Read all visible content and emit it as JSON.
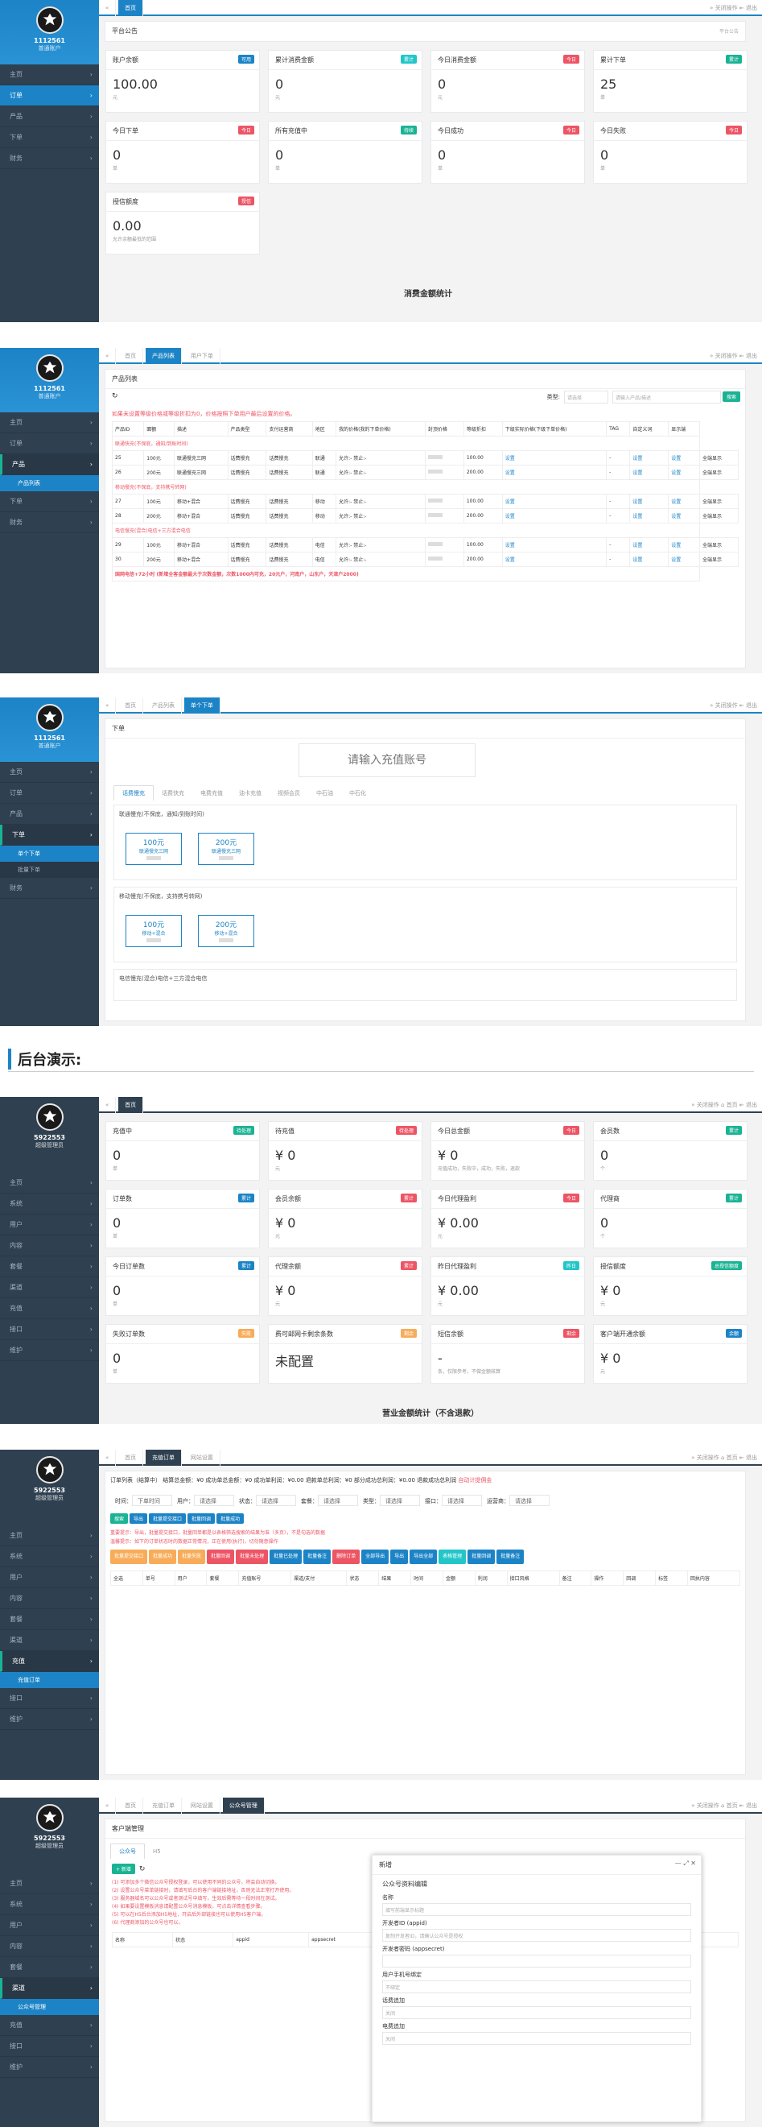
{
  "common": {
    "user_name": "1112561",
    "user_role": "普通账户",
    "admin_name": "5922553",
    "admin_role": "超级管理员",
    "close_ops": "关闭操作",
    "exit": "退出",
    "home": "首页"
  },
  "panel1": {
    "menu": [
      "主页",
      "订单",
      "产品",
      "下单",
      "财务"
    ],
    "notice_title": "平台公告",
    "notice_right": "平台公告",
    "cards": [
      {
        "title": "账户余额",
        "badge": "可用",
        "badge_color": "#1c84c6",
        "value": "100.00",
        "unit": "元"
      },
      {
        "title": "累计消费金额",
        "badge": "累计",
        "badge_color": "#23c6c8",
        "value": "0",
        "unit": "元"
      },
      {
        "title": "今日消费金额",
        "badge": "今日",
        "badge_color": "#ed5565",
        "value": "0",
        "unit": "元"
      },
      {
        "title": "累计下单",
        "badge": "累计",
        "badge_color": "#1ab394",
        "value": "25",
        "unit": "单"
      },
      {
        "title": "今日下单",
        "badge": "今日",
        "badge_color": "#ed5565",
        "value": "0",
        "unit": "单"
      },
      {
        "title": "所有充值中",
        "badge": "待续",
        "badge_color": "#1ab394",
        "value": "0",
        "unit": "单"
      },
      {
        "title": "今日成功",
        "badge": "今日",
        "badge_color": "#ed5565",
        "value": "0",
        "unit": "单"
      },
      {
        "title": "今日失败",
        "badge": "今日",
        "badge_color": "#ed5565",
        "value": "0",
        "unit": "单"
      },
      {
        "title": "授信额度",
        "badge": "授信",
        "badge_color": "#ed5565",
        "value": "0.00",
        "unit": "允许余额最低的范围"
      }
    ],
    "caption": "消费金额统计"
  },
  "panel2": {
    "menu": [
      "主页",
      "订单",
      "产品",
      "下单",
      "财务"
    ],
    "submenu": "产品列表",
    "tabs": [
      "首页",
      "产品列表",
      "用户下单"
    ],
    "title": "产品列表",
    "type_label": "类型:",
    "type_select": "请选择",
    "search_placeholder": "请输入产品/描述",
    "search_btn": "搜索",
    "notice": "如果未设置等级价格或等级折扣为0，价格按照下单用户最后设置的价格。",
    "headers": [
      "产品ID",
      "面额",
      "描述",
      "产品类型",
      "支付运营商",
      "地区",
      "我的价格(我的下单价格)",
      "封顶价格",
      "等级折扣",
      "下级实际价格(下级下单价格)",
      "TAG",
      "自定义词",
      "显示端"
    ],
    "sections": [
      {
        "label": "联通快充(不保底，通知/到账时间)",
        "rows": [
          {
            "id": "25",
            "face": "100元",
            "desc": "联通慢充三网",
            "type": "话费慢充",
            "op": "联通",
            "price": "100.00"
          },
          {
            "id": "26",
            "face": "200元",
            "desc": "联通慢充三网",
            "type": "话费慢充",
            "op": "联通",
            "price": "200.00"
          }
        ]
      },
      {
        "label": "移动慢充(不保底，支持携号转网)",
        "rows": [
          {
            "id": "27",
            "face": "100元",
            "desc": "移动+混合",
            "type": "话费慢充",
            "op": "移动",
            "price": "100.00"
          },
          {
            "id": "28",
            "face": "200元",
            "desc": "移动+混合",
            "type": "话费慢充",
            "op": "移动",
            "price": "200.00"
          }
        ]
      },
      {
        "label": "电信慢充(混合)电信+三方混合电信",
        "rows": [
          {
            "id": "29",
            "face": "100元",
            "desc": "移动+混合",
            "type": "话费慢充",
            "op": "电信",
            "price": "100.00"
          },
          {
            "id": "30",
            "face": "200元",
            "desc": "移动+混合",
            "type": "话费慢充",
            "op": "电信",
            "price": "200.00"
          }
        ]
      }
    ],
    "region": "允许:- 禁止:-",
    "set_label": "设置",
    "display_label": "全端显示",
    "footer_notice": "国网电信+72小时 (新增全客金额最大于次数金额，次数1000内可充，20元户，河南户，山东户，天津户2000)"
  },
  "panel3": {
    "menu": [
      "主页",
      "订单",
      "产品",
      "下单",
      "财务"
    ],
    "submenu": [
      "单个下单",
      "批量下单"
    ],
    "tabs": [
      "首页",
      "产品列表",
      "单个下单"
    ],
    "title": "下单",
    "input_placeholder": "请输入充值账号",
    "subtabs": [
      "话费慢充",
      "话费快充",
      "电费充值",
      "油卡充值",
      "视频会员",
      "中石油",
      "中石化"
    ],
    "groups": [
      {
        "title": "联通慢充(不保底，通知/到账时间)",
        "options": [
          {
            "face": "100元",
            "sub": "联通慢充三网"
          },
          {
            "face": "200元",
            "sub": "联通慢充三网"
          }
        ]
      },
      {
        "title": "移动慢充(不保底，支持携号转网)",
        "options": [
          {
            "face": "100元",
            "sub": "移动+混合"
          },
          {
            "face": "200元",
            "sub": "移动+混合"
          }
        ]
      },
      {
        "title": "电信慢充(混合)电信+三方混合电信",
        "options": []
      }
    ]
  },
  "demo_title": "后台演示:",
  "panel4": {
    "menu": [
      "主页",
      "系统",
      "用户",
      "内容",
      "套餐",
      "渠道",
      "充值",
      "接口",
      "维护"
    ],
    "cards": [
      {
        "title": "充值中",
        "badge": "待处理",
        "badge_color": "#1ab394",
        "value": "0",
        "unit": "单"
      },
      {
        "title": "待充值",
        "badge": "待处理",
        "badge_color": "#ed5565",
        "value": "¥ 0",
        "unit": "元"
      },
      {
        "title": "今日总金额",
        "badge": "今日",
        "badge_color": "#ed5565",
        "value": "¥ 0",
        "unit": "充值成功，失败中，成功，失败，退款"
      },
      {
        "title": "会员数",
        "badge": "累计",
        "badge_color": "#1ab394",
        "value": "0",
        "unit": "个"
      },
      {
        "title": "订单数",
        "badge": "累计",
        "badge_color": "#1c84c6",
        "value": "0",
        "unit": "单"
      },
      {
        "title": "会员余额",
        "badge": "累计",
        "badge_color": "#ed5565",
        "value": "¥ 0",
        "unit": "元"
      },
      {
        "title": "今日代理盈利",
        "badge": "今日",
        "badge_color": "#ed5565",
        "value": "¥ 0.00",
        "unit": "元"
      },
      {
        "title": "代理商",
        "badge": "累计",
        "badge_color": "#1ab394",
        "value": "0",
        "unit": "个"
      },
      {
        "title": "今日订单数",
        "badge": "累计",
        "badge_color": "#1c84c6",
        "value": "0",
        "unit": "单"
      },
      {
        "title": "代理余额",
        "badge": "累计",
        "badge_color": "#ed5565",
        "value": "¥ 0",
        "unit": "元"
      },
      {
        "title": "昨日代理盈利",
        "badge": "昨日",
        "badge_color": "#23c6c8",
        "value": "¥ 0.00",
        "unit": "元"
      },
      {
        "title": "授信额度",
        "badge": "总授信额度",
        "badge_color": "#1ab394",
        "value": "¥ 0",
        "unit": "元"
      },
      {
        "title": "失败订单数",
        "badge": "失败",
        "badge_color": "#f8ac59",
        "value": "0",
        "unit": "单"
      },
      {
        "title": "费可邮网卡剩余条数",
        "badge": "剩余",
        "badge_color": "#f8ac59",
        "value": "未配置",
        "unit": ""
      },
      {
        "title": "短信余额",
        "badge": "剩余",
        "badge_color": "#ed5565",
        "value": "-",
        "unit": "条，仅限参考，不做金额核算"
      },
      {
        "title": "客户端开通余额",
        "badge": "余额",
        "badge_color": "#1c84c6",
        "value": "¥ 0",
        "unit": "元"
      }
    ],
    "caption": "营业金额统计（不含退款）"
  },
  "panel5": {
    "menu": [
      "主页",
      "系统",
      "用户",
      "内容",
      "套餐",
      "渠道",
      "充值",
      "接口",
      "维护"
    ],
    "submenu": "充值订单",
    "tabs": [
      "首页",
      "充值订单",
      "网站设置"
    ],
    "summary": "订单列表（结算中）  结算总金额：¥0  成功单总金额：¥0  成功单利润：¥0.00  退款单总利润：¥0  部分成功总利润：¥0.00  退款成功总利润",
    "summary_red": "自动计提佣金",
    "filter_labels": [
      "时间",
      "用户",
      "状态",
      "套餐",
      "类型",
      "接口",
      "运营商"
    ],
    "select_default": "请选择",
    "time_select": "下单时间",
    "notice1": "重要提示：导出，批量提交接口，批量回单都是以表格筛选搜索的结果为准（多页），不是勾选的数据",
    "notice2": "温馨提示：如下的订单状态时的数据正常情况，正在使用(执行)，切勿随意操作",
    "actions": [
      {
        "label": "批量提交接口",
        "color": "#f8ac59"
      },
      {
        "label": "批量成功",
        "color": "#f8ac59"
      },
      {
        "label": "批量失败",
        "color": "#f8ac59"
      },
      {
        "label": "批量回调",
        "color": "#ed5565"
      },
      {
        "label": "批量未处理",
        "color": "#ed5565"
      },
      {
        "label": "批量已处理",
        "color": "#1c84c6"
      },
      {
        "label": "批量备注",
        "color": "#1c84c6"
      },
      {
        "label": "删除订单",
        "color": "#ed5565"
      },
      {
        "label": "全部导出",
        "color": "#1c84c6"
      },
      {
        "label": "导出",
        "color": "#1c84c6"
      },
      {
        "label": "导出全部",
        "color": "#1c84c6"
      },
      {
        "label": "表格管理",
        "color": "#23c6c8"
      },
      {
        "label": "批量回调",
        "color": "#1c84c6"
      },
      {
        "label": "批量备注",
        "color": "#1c84c6"
      }
    ],
    "headers": [
      "全选",
      "单号",
      "用户",
      "套餐",
      "充值账号",
      "渠道/支付",
      "状态",
      "结果",
      "时间",
      "金额",
      "利润",
      "接口风格",
      "备注",
      "操作",
      "回调",
      "标签",
      "回执内容"
    ],
    "search_btns": [
      "搜索",
      "导出",
      "批量提交接口",
      "批量回调",
      "批量成功"
    ]
  },
  "panel6": {
    "menu": [
      "主页",
      "系统",
      "用户",
      "内容",
      "套餐",
      "渠道",
      "充值",
      "接口",
      "维护"
    ],
    "submenu": "公众号管理",
    "tabs": [
      "首页",
      "充值订单",
      "网站设置",
      "公众号管理"
    ],
    "title": "客户端管理",
    "subtabs": [
      "公众号",
      "H5"
    ],
    "add_btn": "+ 新增",
    "notes": [
      "(1) 可添加多个微信公众号授权登录，可以使用不同的公众号，将会自动切换。",
      "(2) 设置公众号菜单链接时，请填写后台的客户端链接地址，否则无法正常打开使用。",
      "(3) 服务器域名可以公众号或者测试号中填写，生效后需等待一段时间在测试。",
      "(4) 如果要设置模板消息请配置公众号消息模板，可点击详情查看步骤。",
      "(5) 可以在H5后台添加H5地址，开启后外部链接也可以使用H5客户端。",
      "(6) 代理商添加的公众号也可以。"
    ],
    "headers": [
      "名称",
      "状态",
      "appid",
      "appsecret",
      "token",
      "encodingaeskey",
      "操作"
    ],
    "modal": {
      "title": "新增",
      "section": "公众号资料编辑",
      "fields": [
        {
          "label": "名称",
          "placeholder": "填写前端显示标题"
        },
        {
          "label": "开发者ID (appid)",
          "placeholder": "复制开发者ID，请确认公众号是授权"
        },
        {
          "label": "开发者密码 (appsecret)",
          "placeholder": ""
        },
        {
          "label": "用户手机号绑定",
          "placeholder": "不绑定"
        },
        {
          "label": "话费追加",
          "placeholder": "关闭"
        },
        {
          "label": "电费追加",
          "placeholder": "关闭"
        }
      ]
    }
  }
}
